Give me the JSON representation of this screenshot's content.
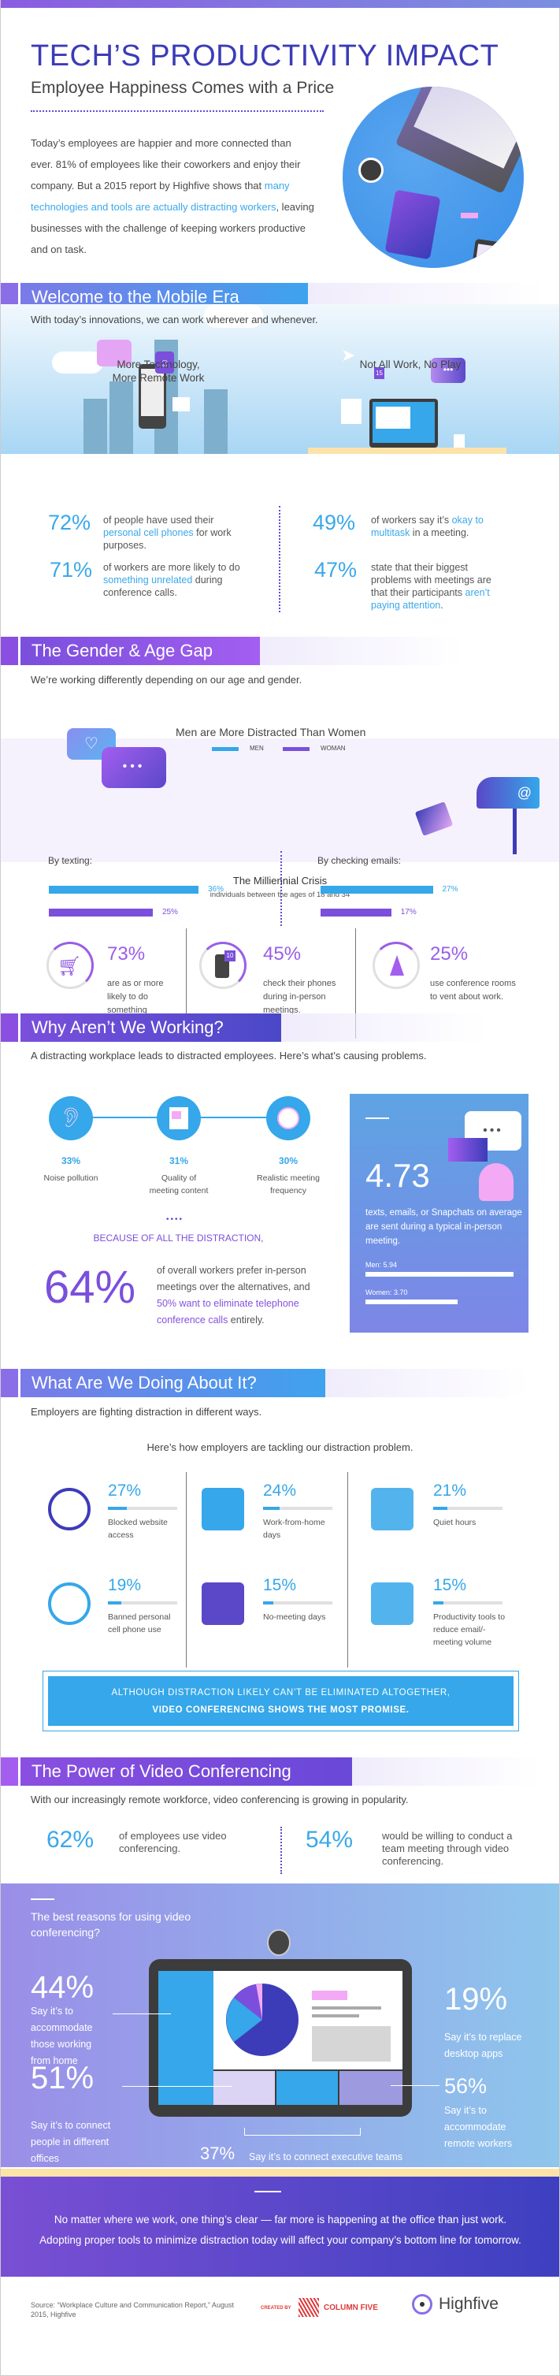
{
  "header": {
    "title": "TECH’S PRODUCTIVITY IMPACT",
    "subtitle": "Employee Happiness Comes with a Price",
    "intro_part1": "Today’s employees are happier and more connected than ever. 81% of employees like their coworkers and enjoy their company. But a 2015 report by Highfive shows that ",
    "intro_link": "many technologies and tools are actually distracting workers",
    "intro_part2": ", leaving businesses with the challenge of keeping workers productive and on task."
  },
  "colors": {
    "primary_blue": "#35a7ea",
    "primary_purple": "#7b4fdc",
    "title_indigo": "#3b3bb8",
    "accent_pink": "#f4a9f4",
    "footer_yellow": "#fde3a8"
  },
  "mobile_era": {
    "heading": "Welcome to the Mobile Era",
    "lead": "With today’s innovations, we can work wherever and whenever.",
    "left_title_1": "More Technology,",
    "left_title_2": "More Remote Work",
    "right_title": "Not All Work, No Play",
    "badge": "15",
    "stats": [
      {
        "pct": "72%",
        "pre": "of people have used their ",
        "hl": "personal cell phones",
        "post": " for work purposes."
      },
      {
        "pct": "71%",
        "pre": "of workers are more likely to do ",
        "hl": "something unrelated",
        "post": " during conference calls."
      },
      {
        "pct": "49%",
        "pre": "of workers say it’s ",
        "hl": "okay to multitask",
        "post": " in a meeting."
      },
      {
        "pct": "47%",
        "pre": "state that their biggest problems with meetings are that their participants ",
        "hl": "aren’t paying attention",
        "post": "."
      }
    ]
  },
  "gender": {
    "heading": "The Gender & Age Gap",
    "lead": "We’re working differently depending on our age and gender.",
    "chart_title": "Men are More Distracted Than Women",
    "legend_men": "MEN",
    "legend_women": "WOMAN",
    "texting_label": "By texting:",
    "emails_label": "By checking emails:",
    "texting": {
      "men": 36,
      "women": 25,
      "men_label": "36%",
      "women_label": "25%"
    },
    "emails": {
      "men": 27,
      "women": 17,
      "men_label": "27%",
      "women_label": "17%"
    },
    "millennial_title": "The Milliennial Crisis",
    "millennial_sub": "individuals between the ages of 18 and 34",
    "millennial": [
      {
        "pct": "73%",
        "text": "are as or more likely to do something unrelated during conference calls."
      },
      {
        "pct": "45%",
        "text": "check their phones during in-person meetings.",
        "badge": "10"
      },
      {
        "pct": "25%",
        "text": "use conference rooms to vent about work."
      }
    ]
  },
  "why": {
    "heading": "Why Aren’t We Working?",
    "lead": "A distracting workplace leads to distracted employees. Here’s what’s causing problems.",
    "causes": [
      {
        "pct": "33%",
        "label": "Noise pollution"
      },
      {
        "pct": "31%",
        "label": "Quality of meeting content"
      },
      {
        "pct": "30%",
        "label": "Realistic meeting frequency"
      }
    ],
    "because": "BECAUSE OF ALL THE DISTRACTION,",
    "big_pct": "64%",
    "big_pre": "of overall workers prefer in-person meetings over the alternatives, and ",
    "big_hl": "50% want to eliminate telephone conference calls",
    "big_post": " entirely.",
    "card": {
      "number": "4.73",
      "text": "texts, emails, or Snapchats on average are sent during a typical in-person meeting.",
      "men_label": "Men: 5.94",
      "women_label": "Women: 3.70",
      "men_value": 5.94,
      "women_value": 3.7
    }
  },
  "doing": {
    "heading": "What Are We Doing About It?",
    "lead": "Employers are fighting distraction in different ways.",
    "sub": "Here’s how employers are tackling our distraction problem.",
    "items": [
      {
        "pct": "27%",
        "value": 27,
        "label": "Blocked website access"
      },
      {
        "pct": "24%",
        "value": 24,
        "label": "Work-from-home days"
      },
      {
        "pct": "21%",
        "value": 21,
        "label": "Quiet hours"
      },
      {
        "pct": "19%",
        "value": 19,
        "label": "Banned personal cell phone use"
      },
      {
        "pct": "15%",
        "value": 15,
        "label": "No-meeting days"
      },
      {
        "pct": "15%",
        "value": 15,
        "label": "Productivity tools to reduce email/-meeting volume"
      }
    ],
    "promise_line1": "ALTHOUGH DISTRACTION LIKELY CAN’T BE ELIMINATED ALTOGETHER,",
    "promise_line2": "VIDEO CONFERENCING SHOWS THE MOST PROMISE."
  },
  "video": {
    "heading": "The Power of Video Conferencing",
    "lead": "With our increasingly remote workforce, video conferencing is growing in popularity.",
    "stats": [
      {
        "pct": "62%",
        "text": "of employees use video conferencing."
      },
      {
        "pct": "54%",
        "text": "would be willing to conduct a team meeting through video conferencing."
      }
    ],
    "reasons_title": "The best reasons for using video conferencing?",
    "reasons": [
      {
        "pct": "44%",
        "text": "Say it’s to accommodate those working from home"
      },
      {
        "pct": "51%",
        "text": "Say it’s to connect people in different offices"
      },
      {
        "pct": "19%",
        "text": "Say it’s to replace desktop apps"
      },
      {
        "pct": "56%",
        "text": "Say it’s to accommodate remote workers"
      },
      {
        "pct": "37%",
        "text": "Say it’s to connect executive teams"
      }
    ]
  },
  "closing": {
    "text": "No matter where we work, one thing’s clear — far more is happening at the office than just work. Adopting proper tools to minimize distraction today will affect your company’s bottom line for tomorrow."
  },
  "footer": {
    "source": "Source: “Workplace Culture and Communication Report,” August 2015, Highfive",
    "created_by": "CREATED BY",
    "agency": "COLUMN FIVE",
    "brand": "Highfive"
  }
}
